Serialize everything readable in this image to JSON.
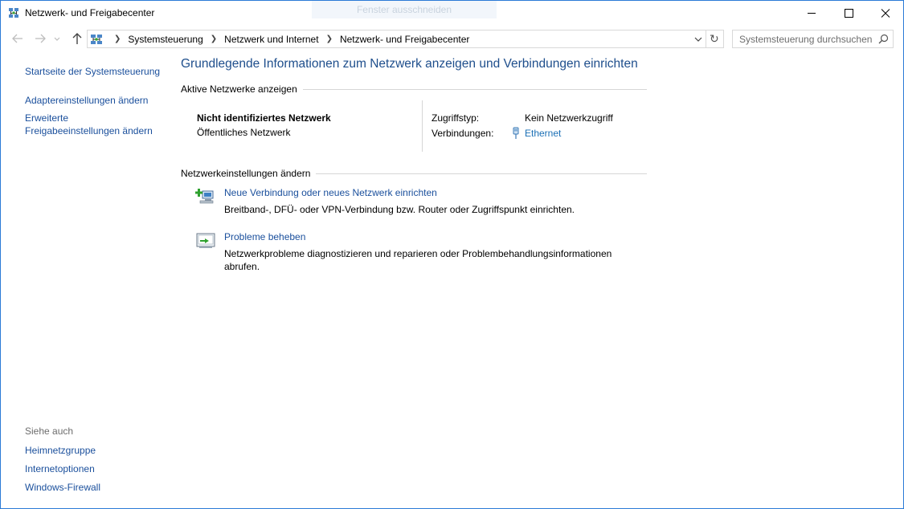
{
  "window": {
    "title": "Netzwerk- und Freigabecenter",
    "snip_hint": "Fenster ausschneiden"
  },
  "address": {
    "crumbs": [
      "Systemsteuerung",
      "Netzwerk und Internet",
      "Netzwerk- und Freigabecenter"
    ]
  },
  "search": {
    "placeholder": "Systemsteuerung durchsuchen"
  },
  "leftnav": {
    "home": "Startseite der Systemsteuerung",
    "adapter": "Adaptereinstellungen ändern",
    "sharing_line1": "Erweiterte",
    "sharing_line2": "Freigabeeinstellungen ändern"
  },
  "seealso": {
    "title": "Siehe auch",
    "items": [
      "Heimnetzgruppe",
      "Internetoptionen",
      "Windows-Firewall"
    ]
  },
  "main": {
    "title": "Grundlegende Informationen zum Netzwerk anzeigen und Verbindungen einrichten",
    "active_header": "Aktive Netzwerke anzeigen",
    "network": {
      "name": "Nicht identifiziertes Netzwerk",
      "type": "Öffentliches Netzwerk",
      "access_label": "Zugriffstyp:",
      "access_value": "Kein Netzwerkzugriff",
      "connections_label": "Verbindungen:",
      "connections_value": "Ethernet"
    },
    "settings_header": "Netzwerkeinstellungen ändern",
    "tasks": [
      {
        "link": "Neue Verbindung oder neues Netzwerk einrichten",
        "desc": "Breitband-, DFÜ- oder VPN-Verbindung bzw. Router oder Zugriffspunkt einrichten."
      },
      {
        "link": "Probleme beheben",
        "desc_line1": "Netzwerkprobleme diagnostizieren und reparieren oder Problembehandlungsinformationen",
        "desc_line2": "abrufen."
      }
    ]
  },
  "colors": {
    "link": "#1a4f9c",
    "title": "#1e4e8c",
    "window_border": "#2b7ad6"
  }
}
